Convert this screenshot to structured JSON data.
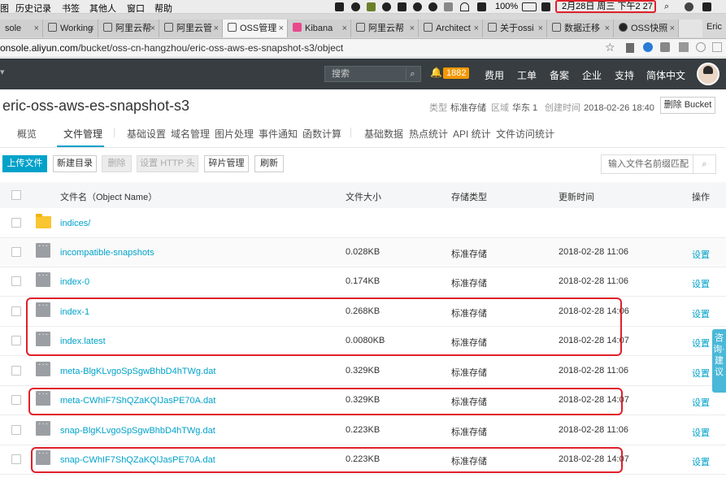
{
  "menubar": {
    "items": [
      "图",
      "历史记录",
      "书签",
      "其他人",
      "窗口",
      "帮助"
    ],
    "battery": "100%",
    "clock": "2月28日 周三 下午2 27"
  },
  "tabs": [
    {
      "label": "sole"
    },
    {
      "label": "Working"
    },
    {
      "label": "阿里云帮"
    },
    {
      "label": "阿里云管"
    },
    {
      "label": "OSS管理"
    },
    {
      "label": "Kibana"
    },
    {
      "label": "阿里云帮"
    },
    {
      "label": "Architect"
    },
    {
      "label": "关于ossi"
    },
    {
      "label": "数据迁移"
    },
    {
      "label": "OSS快照"
    }
  ],
  "tab_close": "×",
  "profile_name": "Eric",
  "address": {
    "host": "onsole.aliyun.com",
    "path": "/bucket/oss-cn-hangzhou/eric-oss-aws-es-snapshot-s3/object"
  },
  "topnav": {
    "search_placeholder": "搜索",
    "badge": "1882",
    "links": [
      "费用",
      "工单",
      "备案",
      "企业",
      "支持",
      "简体中文"
    ]
  },
  "bucket": {
    "name": "eric-oss-aws-es-snapshot-s3",
    "type_label": "类型",
    "type_value": "标准存储",
    "region_label": "区域",
    "region_value": "华东 1",
    "created_label": "创建时间",
    "created_value": "2018-02-26 18:40",
    "delete_button": "删除 Bucket"
  },
  "subnav": [
    "概览",
    "文件管理",
    "基础设置",
    "域名管理",
    "图片处理",
    "事件通知",
    "函数计算",
    "基础数据",
    "热点统计",
    "API 统计",
    "文件访问统计"
  ],
  "toolbar": {
    "upload": "上传文件",
    "new_dir": "新建目录",
    "delete": "删除",
    "http_header": "设置 HTTP 头",
    "fragments": "碎片管理",
    "refresh": "刷新",
    "search_placeholder": "输入文件名前缀匹配"
  },
  "table": {
    "headers": [
      "文件名（Object Name）",
      "文件大小",
      "存储类型",
      "更新时间",
      "操作"
    ],
    "rows": [
      {
        "name": "indices/",
        "size": "",
        "type": "",
        "time": "",
        "action": "",
        "kind": "folder"
      },
      {
        "name": "incompatible-snapshots",
        "size": "0.028KB",
        "type": "标准存储",
        "time": "2018-02-28 11:06",
        "action": "设置",
        "kind": "file"
      },
      {
        "name": "index-0",
        "size": "0.174KB",
        "type": "标准存储",
        "time": "2018-02-28 11:06",
        "action": "设置",
        "kind": "file"
      },
      {
        "name": "index-1",
        "size": "0.268KB",
        "type": "标准存储",
        "time": "2018-02-28 14:06",
        "action": "设置",
        "kind": "file"
      },
      {
        "name": "index.latest",
        "size": "0.0080KB",
        "type": "标准存储",
        "time": "2018-02-28 14:07",
        "action": "设置",
        "kind": "file"
      },
      {
        "name": "meta-BlgKLvgoSpSgwBhbD4hTWg.dat",
        "size": "0.329KB",
        "type": "标准存储",
        "time": "2018-02-28 11:06",
        "action": "设置",
        "kind": "file"
      },
      {
        "name": "meta-CWhIF7ShQZaKQlJasPE70A.dat",
        "size": "0.329KB",
        "type": "标准存储",
        "time": "2018-02-28 14:07",
        "action": "设置",
        "kind": "file"
      },
      {
        "name": "snap-BlgKLvgoSpSgwBhbD4hTWg.dat",
        "size": "0.223KB",
        "type": "标准存储",
        "time": "2018-02-28 11:06",
        "action": "设置",
        "kind": "file"
      },
      {
        "name": "snap-CWhIF7ShQZaKQlJasPE70A.dat",
        "size": "0.223KB",
        "type": "标准存储",
        "time": "2018-02-28 14:07",
        "action": "设置",
        "kind": "file"
      }
    ]
  },
  "consult": "咨询·建议",
  "colors": {
    "accent": "#00a2ca",
    "nav_bg": "#373d41",
    "badge": "#f39800",
    "highlight": "#e0202a"
  }
}
